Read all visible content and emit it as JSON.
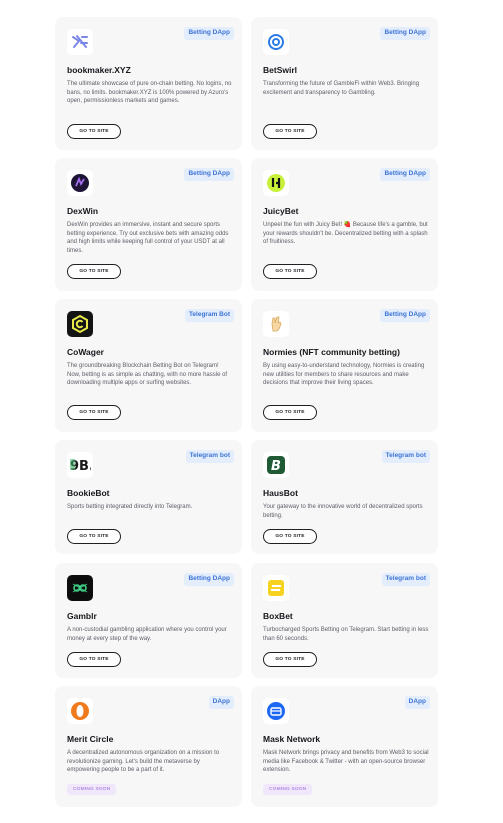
{
  "cards": [
    {
      "title": "bookmaker.XYZ",
      "badge": "Betting DApp",
      "icon": "bookmaker-logo-icon",
      "description": "The ultimate showcase of pure on-chain betting. No logins, no bans, no limits. bookmaker.XYZ is 100% powered by Azuro's open, permissionless markets and games.",
      "action": "GO TO SITE"
    },
    {
      "title": "BetSwirl",
      "badge": "Betting DApp",
      "icon": "betswirl-logo-icon",
      "description": "Transforming the future of GambleFi within Web3. Bringing excitement and transparency to Gambling.",
      "action": "GO TO SITE"
    },
    {
      "title": "DexWin",
      "badge": "Betting DApp",
      "icon": "dexwin-logo-icon",
      "description": "DexWin provides an immersive, instant and secure sports betting experience. Try out exclusive bets with amazing odds and high limits while keeping full control of your USDT at all times.",
      "action": "GO TO SITE"
    },
    {
      "title": "JuicyBet",
      "badge": "Betting DApp",
      "icon": "juicybet-logo-icon",
      "description": "Unpeel the fun with Juicy Bet! 🍓 Because life's a gamble, but your rewards shouldn't be. Decentralized betting with a splash of fruitiness.",
      "action": "GO TO SITE"
    },
    {
      "title": "CoWager",
      "badge": "Telegram Bot",
      "icon": "cowager-logo-icon",
      "description": "The groundbreaking Blockchain Betting Bot on Telegram! Now, betting is as simple as chatting, with no more hassle of downloading multiple apps or surfing websites.",
      "action": "GO TO SITE"
    },
    {
      "title": "Normies (NFT community betting)",
      "badge": "Betting DApp",
      "icon": "normies-hand-logo-icon",
      "description": "By using easy-to-understand technology, Normies is creating new utilities for members to share resources and make decisions that improve their living spaces.",
      "action": "GO TO SITE"
    },
    {
      "title": "BookieBot",
      "badge": "Telegram bot",
      "icon": "bookiebot-logo-icon",
      "description": "Sports betting integrated directly into Telegram.",
      "action": "GO TO SITE"
    },
    {
      "title": "HausBot",
      "badge": "Telegram bot",
      "icon": "hausbot-logo-icon",
      "description": "Your gateway to the innovative world of decentralized sports betting.",
      "action": "GO TO SITE"
    },
    {
      "title": "Gamblr",
      "badge": "Betting DApp",
      "icon": "gamblr-logo-icon",
      "description": "A non-custodial gambling application where you control your money at every step of the way.",
      "action": "GO TO SITE"
    },
    {
      "title": "BoxBet",
      "badge": "Telegram bot",
      "icon": "boxbet-logo-icon",
      "description": "Turbocharged Sports Betting on Telegram. Start betting in less than 60 seconds.",
      "action": "GO TO SITE"
    },
    {
      "title": "Merit Circle",
      "badge": "DApp",
      "icon": "merit-circle-logo-icon",
      "description": "A decentralized autonomous organization on a mission to revolutionize gaming. Let's build the metaverse by empowering people to be a part of it.",
      "status": "COMING SOON"
    },
    {
      "title": "Mask Network",
      "badge": "DApp",
      "icon": "mask-network-logo-icon",
      "description": "Mask Network brings privacy and benefits from Web3 to social media like Facebook & Twitter - with an open-source browser extension.",
      "status": "COMING SOON"
    }
  ]
}
